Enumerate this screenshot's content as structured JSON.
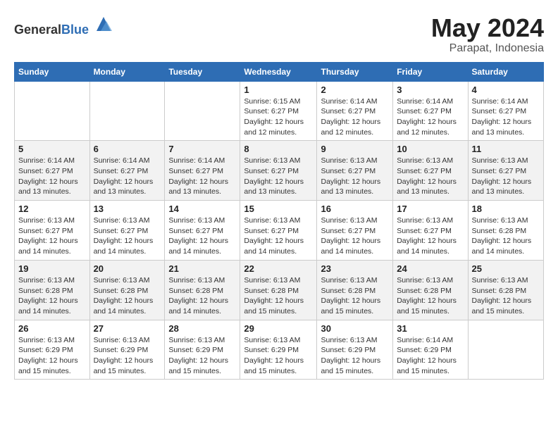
{
  "header": {
    "logo_general": "General",
    "logo_blue": "Blue",
    "month": "May 2024",
    "location": "Parapat, Indonesia"
  },
  "weekdays": [
    "Sunday",
    "Monday",
    "Tuesday",
    "Wednesday",
    "Thursday",
    "Friday",
    "Saturday"
  ],
  "weeks": [
    [
      {
        "day": "",
        "info": ""
      },
      {
        "day": "",
        "info": ""
      },
      {
        "day": "",
        "info": ""
      },
      {
        "day": "1",
        "info": "Sunrise: 6:15 AM\nSunset: 6:27 PM\nDaylight: 12 hours\nand 12 minutes."
      },
      {
        "day": "2",
        "info": "Sunrise: 6:14 AM\nSunset: 6:27 PM\nDaylight: 12 hours\nand 12 minutes."
      },
      {
        "day": "3",
        "info": "Sunrise: 6:14 AM\nSunset: 6:27 PM\nDaylight: 12 hours\nand 12 minutes."
      },
      {
        "day": "4",
        "info": "Sunrise: 6:14 AM\nSunset: 6:27 PM\nDaylight: 12 hours\nand 13 minutes."
      }
    ],
    [
      {
        "day": "5",
        "info": "Sunrise: 6:14 AM\nSunset: 6:27 PM\nDaylight: 12 hours\nand 13 minutes."
      },
      {
        "day": "6",
        "info": "Sunrise: 6:14 AM\nSunset: 6:27 PM\nDaylight: 12 hours\nand 13 minutes."
      },
      {
        "day": "7",
        "info": "Sunrise: 6:14 AM\nSunset: 6:27 PM\nDaylight: 12 hours\nand 13 minutes."
      },
      {
        "day": "8",
        "info": "Sunrise: 6:13 AM\nSunset: 6:27 PM\nDaylight: 12 hours\nand 13 minutes."
      },
      {
        "day": "9",
        "info": "Sunrise: 6:13 AM\nSunset: 6:27 PM\nDaylight: 12 hours\nand 13 minutes."
      },
      {
        "day": "10",
        "info": "Sunrise: 6:13 AM\nSunset: 6:27 PM\nDaylight: 12 hours\nand 13 minutes."
      },
      {
        "day": "11",
        "info": "Sunrise: 6:13 AM\nSunset: 6:27 PM\nDaylight: 12 hours\nand 13 minutes."
      }
    ],
    [
      {
        "day": "12",
        "info": "Sunrise: 6:13 AM\nSunset: 6:27 PM\nDaylight: 12 hours\nand 14 minutes."
      },
      {
        "day": "13",
        "info": "Sunrise: 6:13 AM\nSunset: 6:27 PM\nDaylight: 12 hours\nand 14 minutes."
      },
      {
        "day": "14",
        "info": "Sunrise: 6:13 AM\nSunset: 6:27 PM\nDaylight: 12 hours\nand 14 minutes."
      },
      {
        "day": "15",
        "info": "Sunrise: 6:13 AM\nSunset: 6:27 PM\nDaylight: 12 hours\nand 14 minutes."
      },
      {
        "day": "16",
        "info": "Sunrise: 6:13 AM\nSunset: 6:27 PM\nDaylight: 12 hours\nand 14 minutes."
      },
      {
        "day": "17",
        "info": "Sunrise: 6:13 AM\nSunset: 6:27 PM\nDaylight: 12 hours\nand 14 minutes."
      },
      {
        "day": "18",
        "info": "Sunrise: 6:13 AM\nSunset: 6:28 PM\nDaylight: 12 hours\nand 14 minutes."
      }
    ],
    [
      {
        "day": "19",
        "info": "Sunrise: 6:13 AM\nSunset: 6:28 PM\nDaylight: 12 hours\nand 14 minutes."
      },
      {
        "day": "20",
        "info": "Sunrise: 6:13 AM\nSunset: 6:28 PM\nDaylight: 12 hours\nand 14 minutes."
      },
      {
        "day": "21",
        "info": "Sunrise: 6:13 AM\nSunset: 6:28 PM\nDaylight: 12 hours\nand 14 minutes."
      },
      {
        "day": "22",
        "info": "Sunrise: 6:13 AM\nSunset: 6:28 PM\nDaylight: 12 hours\nand 15 minutes."
      },
      {
        "day": "23",
        "info": "Sunrise: 6:13 AM\nSunset: 6:28 PM\nDaylight: 12 hours\nand 15 minutes."
      },
      {
        "day": "24",
        "info": "Sunrise: 6:13 AM\nSunset: 6:28 PM\nDaylight: 12 hours\nand 15 minutes."
      },
      {
        "day": "25",
        "info": "Sunrise: 6:13 AM\nSunset: 6:28 PM\nDaylight: 12 hours\nand 15 minutes."
      }
    ],
    [
      {
        "day": "26",
        "info": "Sunrise: 6:13 AM\nSunset: 6:29 PM\nDaylight: 12 hours\nand 15 minutes."
      },
      {
        "day": "27",
        "info": "Sunrise: 6:13 AM\nSunset: 6:29 PM\nDaylight: 12 hours\nand 15 minutes."
      },
      {
        "day": "28",
        "info": "Sunrise: 6:13 AM\nSunset: 6:29 PM\nDaylight: 12 hours\nand 15 minutes."
      },
      {
        "day": "29",
        "info": "Sunrise: 6:13 AM\nSunset: 6:29 PM\nDaylight: 12 hours\nand 15 minutes."
      },
      {
        "day": "30",
        "info": "Sunrise: 6:13 AM\nSunset: 6:29 PM\nDaylight: 12 hours\nand 15 minutes."
      },
      {
        "day": "31",
        "info": "Sunrise: 6:14 AM\nSunset: 6:29 PM\nDaylight: 12 hours\nand 15 minutes."
      },
      {
        "day": "",
        "info": ""
      }
    ]
  ]
}
